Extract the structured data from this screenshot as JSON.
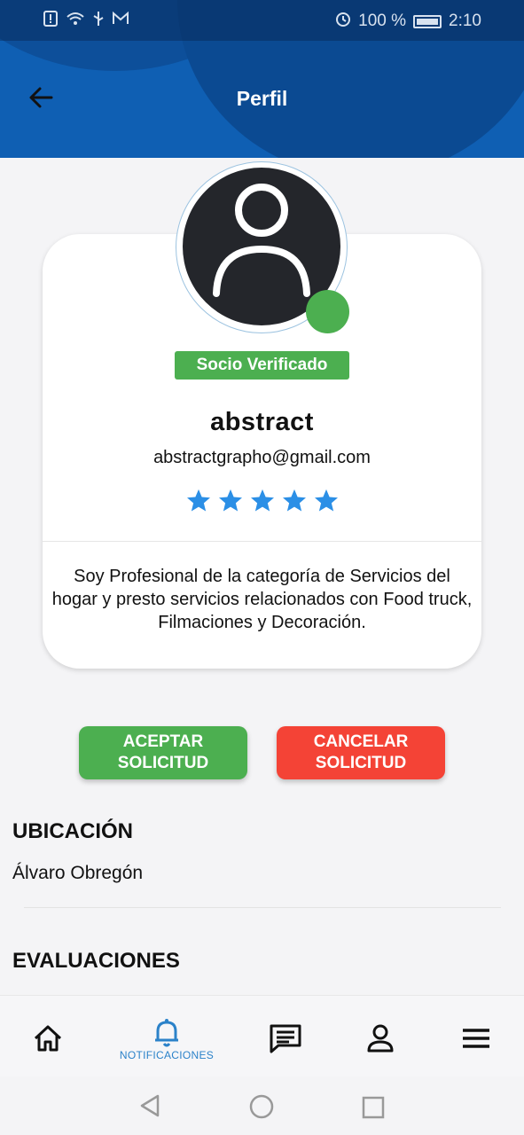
{
  "status_bar": {
    "battery": "100 %",
    "time": "2:10"
  },
  "header": {
    "title": "Perfil"
  },
  "profile": {
    "badge": "Socio Verificado",
    "name": "abstract",
    "email": "abstractgrapho@gmail.com",
    "rating": 5,
    "bio": "Soy Profesional de la categoría de Servicios del hogar y presto servicios relacionados con Food truck, Filmaciones y Decoración."
  },
  "actions": {
    "accept_label": "ACEPTAR SOLICITUD",
    "cancel_label": "CANCELAR SOLICITUD"
  },
  "location": {
    "title": "UBICACIÓN",
    "value": "Álvaro Obregón"
  },
  "reviews": {
    "title": "EVALUACIONES"
  },
  "bottom_nav": {
    "active_label": "NOTIFICACIONES"
  },
  "colors": {
    "header": "#0f5fb3",
    "verified": "#4caf50",
    "accept": "#4caf50",
    "cancel": "#f44336",
    "star": "#2b8fe6",
    "nav_active": "#2b82c9"
  }
}
